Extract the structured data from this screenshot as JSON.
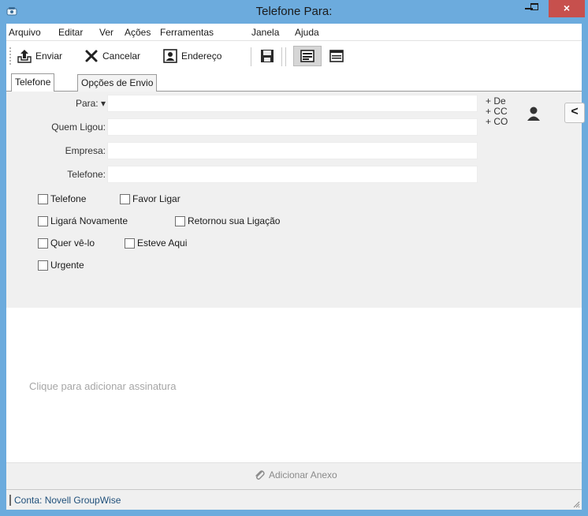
{
  "window": {
    "title": "Telefone Para:",
    "close_glyph": "×",
    "accent": "#6cabdd",
    "close_color": "#c7504d"
  },
  "menu": {
    "items": [
      "Arquivo",
      "Editar",
      "Ver",
      "Ações",
      "Ferramentas",
      "Janela",
      "Ajuda"
    ]
  },
  "toolbar": {
    "send_label": "Enviar",
    "cancel_label": "Cancelar",
    "address_label": "Endereço"
  },
  "tabs": [
    {
      "label": "Telefone",
      "active": true
    },
    {
      "label": "Opções de Envio",
      "active": false
    }
  ],
  "form": {
    "to_label": "Para:",
    "to_dropdown_glyph": "▾",
    "caller_label": "Quem Ligou:",
    "company_label": "Empresa:",
    "phone_label": "Telefone:",
    "to_value": "",
    "caller_value": "",
    "company_value": "",
    "phone_value": "",
    "add_from": "+ De",
    "add_cc": "+ CC",
    "add_bc": "+ CO",
    "collapse_glyph": "<",
    "checkboxes": {
      "phoned": "Telefone",
      "please_call": "Favor Ligar",
      "will_call_again": "Ligará Novamente",
      "returned_call": "Retornou sua Ligação",
      "wants_to_see_you": "Quer vê-lo",
      "came_to_see_you": "Esteve Aqui",
      "urgent": "Urgente"
    }
  },
  "body": {
    "signature_placeholder": "Clique para adicionar assinatura"
  },
  "attach": {
    "label": "Adicionar Anexo"
  },
  "status": {
    "account": "Conta: Novell GroupWise"
  }
}
